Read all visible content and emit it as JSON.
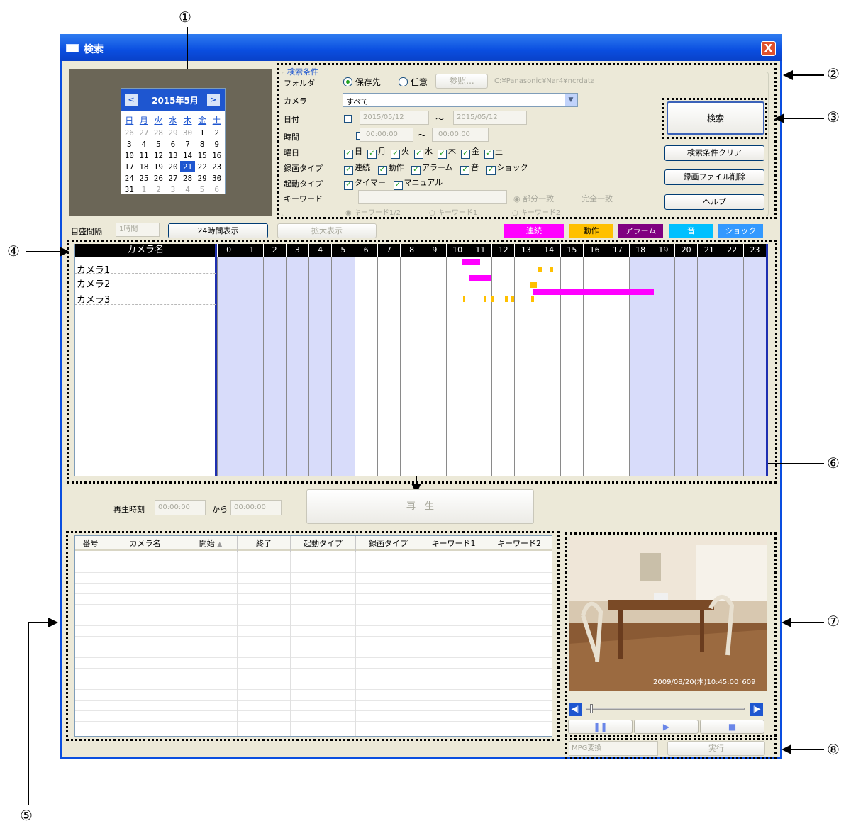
{
  "window": {
    "title": "検索",
    "close_glyph": "X"
  },
  "callouts": [
    "①",
    "②",
    "③",
    "④",
    "⑤",
    "⑥",
    "⑦",
    "⑧"
  ],
  "calendar": {
    "month_label": "2015年5月",
    "prev_glyph": "<",
    "next_glyph": ">",
    "weekdays": [
      "日",
      "月",
      "火",
      "水",
      "木",
      "金",
      "土"
    ],
    "weeks": [
      [
        "26",
        "27",
        "28",
        "29",
        "30",
        "1",
        "2"
      ],
      [
        "3",
        "4",
        "5",
        "6",
        "7",
        "8",
        "9"
      ],
      [
        "10",
        "11",
        "12",
        "13",
        "14",
        "15",
        "16"
      ],
      [
        "17",
        "18",
        "19",
        "20",
        "21",
        "22",
        "23"
      ],
      [
        "24",
        "25",
        "26",
        "27",
        "28",
        "29",
        "30"
      ],
      [
        "31",
        "1",
        "2",
        "3",
        "4",
        "5",
        "6"
      ]
    ],
    "selected": "21"
  },
  "search": {
    "group_title": "検索条件",
    "folder_label": "フォルダ",
    "folder_opt1": "保存先",
    "folder_opt2": "任意",
    "browse_label": "参照...",
    "folder_path": "C:¥Panasonic¥Nar4¥ncrdata",
    "camera_label": "カメラ",
    "camera_value": "すべて",
    "date_label": "日付",
    "date_from": "2015/05/12",
    "date_to": "2015/05/12",
    "tilde": "〜",
    "time_label": "時間",
    "time_from": "00:00:00",
    "time_to": "00:00:00",
    "weekday_label": "曜日",
    "weekdays": [
      "日",
      "月",
      "火",
      "水",
      "木",
      "金",
      "土"
    ],
    "rectype_label": "録画タイプ",
    "rectypes": [
      "連続",
      "動作",
      "アラーム",
      "音",
      "ショック"
    ],
    "trigger_label": "起動タイプ",
    "triggers": [
      "タイマー",
      "マニュアル"
    ],
    "keyword_label": "キーワード",
    "kw_partial": "部分一致",
    "kw_exact": "完全一致",
    "kw1_2": "キーワード1/2",
    "kw1": "キーワード1",
    "kw2": "キーワード2"
  },
  "buttons": {
    "search": "検索",
    "clear": "検索条件クリア",
    "delete": "録画ファイル削除",
    "help": "ヘルプ",
    "show24": "24時間表示",
    "zoom": "拡大表示",
    "play": "再　生",
    "execute": "実行"
  },
  "timeline": {
    "interval_label": "目盛間隔",
    "interval_value": "1時間",
    "legend": [
      {
        "label": "連続",
        "color": "#ff00ff"
      },
      {
        "label": "動作",
        "color": "#ffc000"
      },
      {
        "label": "アラーム",
        "color": "#800080"
      },
      {
        "label": "音",
        "color": "#00c0ff"
      },
      {
        "label": "ショック",
        "color": "#3399ff"
      }
    ],
    "camera_header": "カメラ名",
    "cameras": [
      "カメラ1",
      "カメラ2",
      "カメラ3"
    ],
    "hours": [
      "0",
      "1",
      "2",
      "3",
      "4",
      "5",
      "6",
      "7",
      "8",
      "9",
      "10",
      "11",
      "12",
      "13",
      "14",
      "15",
      "16",
      "17",
      "18",
      "19",
      "20",
      "21",
      "22",
      "23"
    ],
    "events": [
      {
        "camera": 0,
        "start": 10.7,
        "end": 11.5,
        "type": "連続"
      },
      {
        "camera": 0,
        "start": 14.0,
        "end": 14.2,
        "type": "動作"
      },
      {
        "camera": 0,
        "start": 14.55,
        "end": 14.7,
        "type": "動作"
      },
      {
        "camera": 1,
        "start": 11.0,
        "end": 12.0,
        "type": "連続"
      },
      {
        "camera": 1,
        "start": 13.7,
        "end": 14.0,
        "type": "動作"
      },
      {
        "camera": 2,
        "start": 13.8,
        "end": 19.1,
        "type": "連続"
      },
      {
        "camera": 2,
        "start": 10.75,
        "end": 10.82,
        "type": "動作"
      },
      {
        "camera": 2,
        "start": 11.7,
        "end": 11.78,
        "type": "動作"
      },
      {
        "camera": 2,
        "start": 12.0,
        "end": 12.12,
        "type": "動作"
      },
      {
        "camera": 2,
        "start": 12.6,
        "end": 12.75,
        "type": "動作"
      },
      {
        "camera": 2,
        "start": 12.85,
        "end": 13.0,
        "type": "動作"
      },
      {
        "camera": 2,
        "start": 13.75,
        "end": 13.85,
        "type": "動作"
      }
    ]
  },
  "playback": {
    "time_label": "再生時刻",
    "from_time": "00:00:00",
    "kara": "から",
    "to_time": "00:00:00"
  },
  "results": {
    "columns": [
      "番号",
      "カメラ名",
      "開始",
      "終了",
      "起動タイプ",
      "録画タイプ",
      "キーワード1",
      "キーワード2"
    ],
    "sort_glyph": "▲"
  },
  "preview": {
    "timestamp": "2009/08/20(木)10:45:00`609"
  },
  "convert": {
    "value": "MPG変換"
  }
}
